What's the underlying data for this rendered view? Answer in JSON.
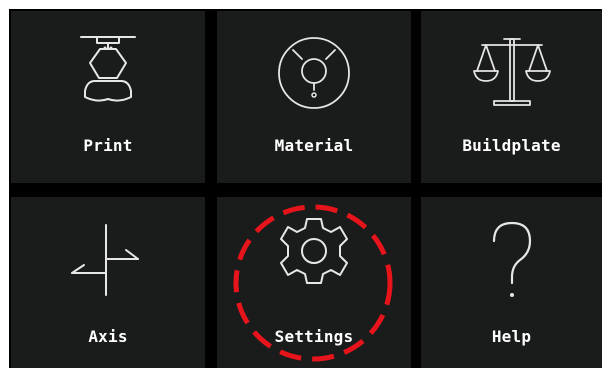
{
  "menu": {
    "tiles": [
      {
        "label": "Print",
        "icon": "print-head-icon"
      },
      {
        "label": "Material",
        "icon": "material-spool-icon"
      },
      {
        "label": "Buildplate",
        "icon": "balance-scale-icon"
      },
      {
        "label": "Axis",
        "icon": "axis-signpost-icon"
      },
      {
        "label": "Settings",
        "icon": "gear-icon"
      },
      {
        "label": "Help",
        "icon": "question-mark-icon"
      }
    ]
  },
  "annotation": {
    "highlighted_tile": "Settings",
    "color": "#e8141b",
    "style": "dashed-circle"
  },
  "colors": {
    "background": "#000000",
    "tile": "#1a1c1b",
    "text": "#ffffff",
    "icon_stroke": "#e6e6e6"
  }
}
